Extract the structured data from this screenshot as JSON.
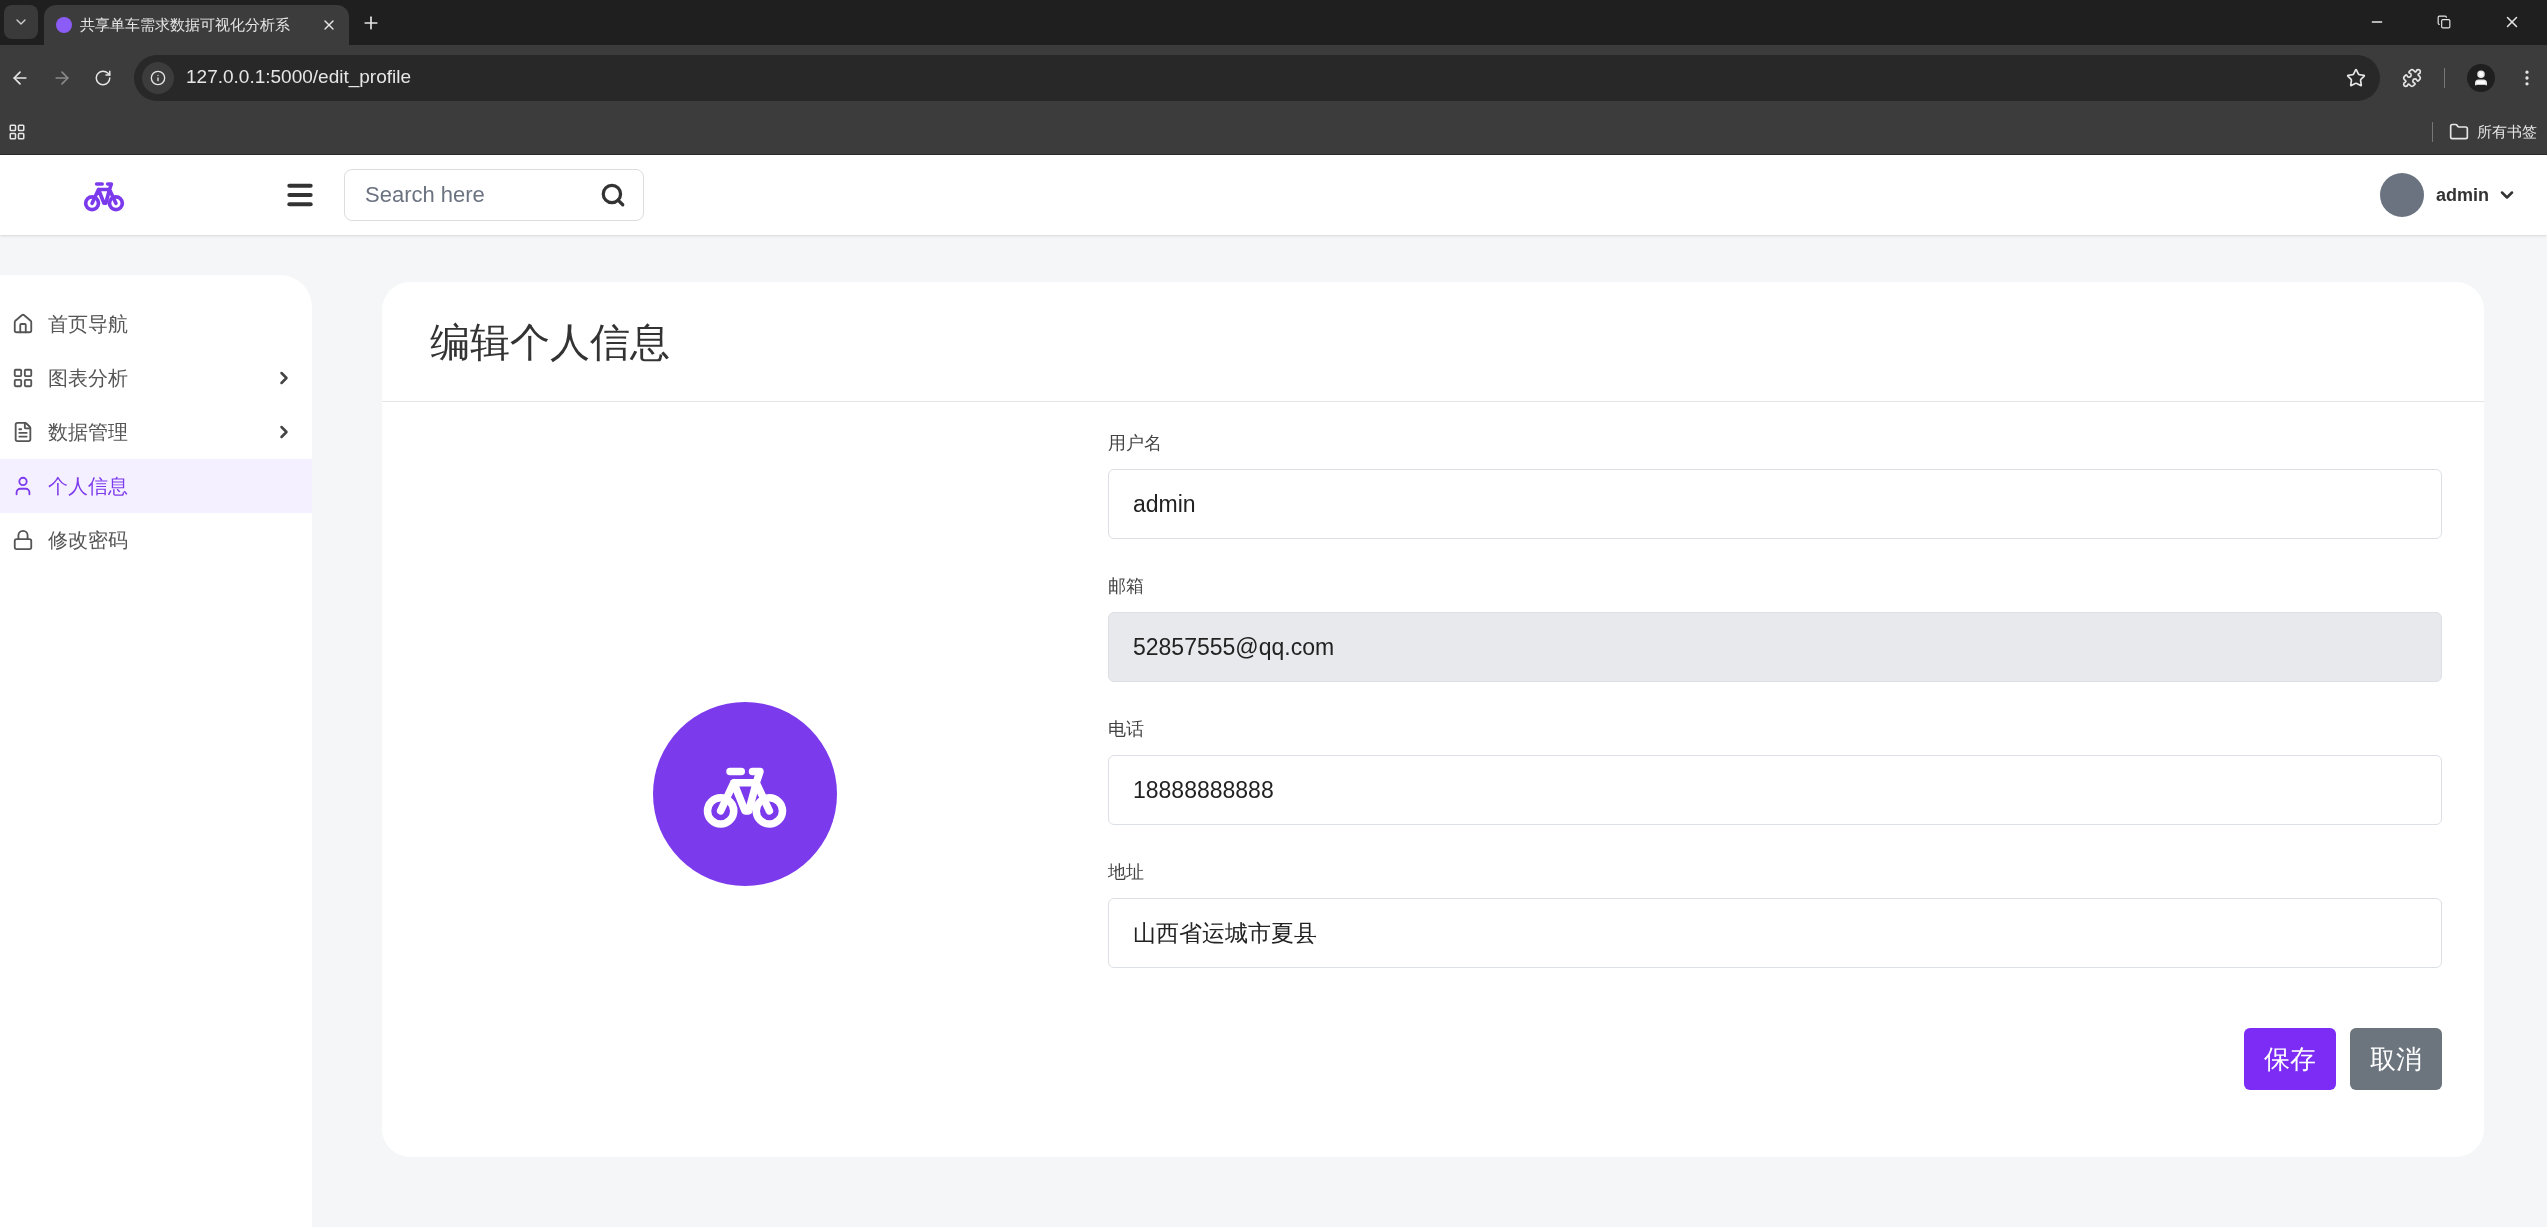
{
  "browser": {
    "tab_title": "共享单车需求数据可视化分析系",
    "url": "127.0.0.1:5000/edit_profile",
    "bookmarks_label": "所有书签"
  },
  "header": {
    "search": {
      "placeholder": "Search here"
    },
    "user": "admin"
  },
  "sidebar": {
    "items": [
      {
        "label": "首页导航",
        "selected": false,
        "has_children": false
      },
      {
        "label": "图表分析",
        "selected": false,
        "has_children": true
      },
      {
        "label": "数据管理",
        "selected": false,
        "has_children": true
      },
      {
        "label": "个人信息",
        "selected": true,
        "has_children": false
      },
      {
        "label": "修改密码",
        "selected": false,
        "has_children": false
      }
    ]
  },
  "card": {
    "title": "编辑个人信息",
    "fields": [
      {
        "label": "用户名",
        "value": "admin",
        "disabled": false
      },
      {
        "label": "邮箱",
        "value": "52857555@qq.com",
        "disabled": true
      },
      {
        "label": "电话",
        "value": "18888888888",
        "disabled": false
      },
      {
        "label": "地址",
        "value": "山西省运城市夏县",
        "disabled": false
      }
    ],
    "buttons": [
      {
        "label": "保存",
        "kind": "primary"
      },
      {
        "label": "取消",
        "kind": "secondary"
      }
    ]
  }
}
